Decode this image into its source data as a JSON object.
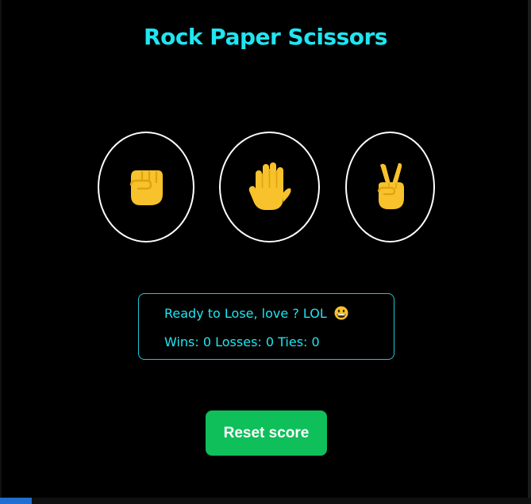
{
  "game": {
    "title": "Rock Paper Scissors",
    "choices": [
      {
        "name": "rock",
        "icon": "raised-fist-icon"
      },
      {
        "name": "paper",
        "icon": "raised-hand-icon"
      },
      {
        "name": "scissors",
        "icon": "victory-hand-icon"
      }
    ]
  },
  "result": {
    "message": "Ready to Lose, love ? LOL",
    "message_icon": "grinning-face-icon",
    "score_text": "Wins: 0 Losses: 0 Ties: 0"
  },
  "controls": {
    "reset_label": "Reset score"
  },
  "colors": {
    "background": "#000000",
    "accent": "#1ee6f2",
    "button": "#0fbf5a",
    "emoji": "#f7c22b"
  }
}
